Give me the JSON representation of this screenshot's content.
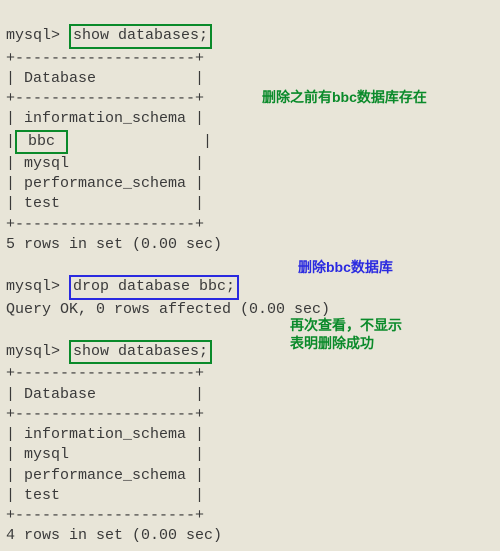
{
  "prompt": "mysql>",
  "cmd_show1": "show databases;",
  "cmd_drop": "drop database bbc;",
  "cmd_show2": "show databases;",
  "sep": "+--------------------+",
  "header": "| Database           |",
  "db1": {
    "r1": "| information_schema |",
    "r2_prefix": "|",
    "r2_name": " bbc ",
    "r2_suffix": "               |",
    "r3": "| mysql              |",
    "r4": "| performance_schema |",
    "r5": "| test               |"
  },
  "result1": "5 rows in set (0.00 sec)",
  "drop_result": "Query OK, 0 rows affected (0.00 sec)",
  "db2": {
    "r1": "| information_schema |",
    "r2": "| mysql              |",
    "r3": "| performance_schema |",
    "r4": "| test               |"
  },
  "result2": "4 rows in set (0.00 sec)",
  "anno": {
    "before": "删除之前有bbc数据库存在",
    "drop": "删除bbc数据库",
    "after_l1": "再次查看，不显示",
    "after_l2": "表明删除成功"
  }
}
